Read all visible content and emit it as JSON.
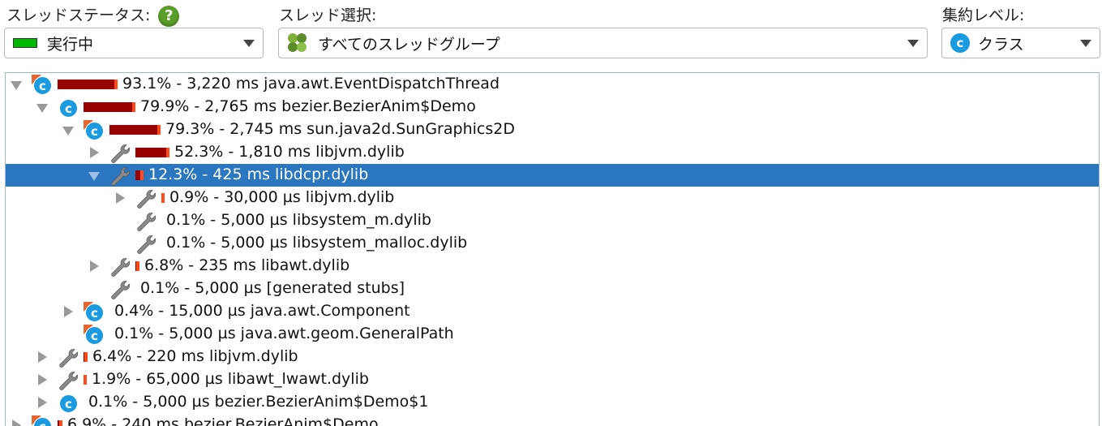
{
  "header": {
    "thread_status_label": "スレッドステータス:",
    "thread_status_value": "実行中",
    "thread_select_label": "スレッド選択:",
    "thread_select_value": "すべてのスレッドグループ",
    "aggregation_label": "集約レベル:",
    "aggregation_value": "クラス",
    "help_glyph": "?",
    "class_glyph": "c"
  },
  "colors": {
    "bar_dark": "#990000",
    "bar_tip": "#ff4a1a",
    "selection": "#2a76bf",
    "class_icon": "#1a9ae0"
  },
  "tree": [
    {
      "text": "93.1% - 3,220 ms java.awt.EventDispatchThread",
      "depth": 0,
      "icon": "class-icon",
      "corner": true,
      "toggle": "expanded",
      "bar_percent": 93.1
    },
    {
      "text": "79.9% - 2,765 ms bezier.BezierAnim$Demo",
      "depth": 1,
      "icon": "class-icon",
      "corner": false,
      "toggle": "expanded",
      "bar_percent": 79.9
    },
    {
      "text": "79.3% - 2,745 ms sun.java2d.SunGraphics2D",
      "depth": 2,
      "icon": "class-icon",
      "corner": true,
      "toggle": "expanded",
      "bar_percent": 79.3
    },
    {
      "text": "52.3% - 1,810 ms libjvm.dylib",
      "depth": 3,
      "icon": "wrench-icon",
      "corner": false,
      "toggle": "collapsed",
      "bar_percent": 52.3
    },
    {
      "text": "12.3% - 425 ms libdcpr.dylib",
      "depth": 3,
      "icon": "wrench-icon",
      "corner": false,
      "toggle": "expanded",
      "bar_percent": 12.3,
      "selected": true
    },
    {
      "text": "0.9% - 30,000 µs libjvm.dylib",
      "depth": 4,
      "icon": "wrench-icon",
      "corner": false,
      "toggle": "collapsed",
      "bar_percent": 0.9
    },
    {
      "text": "0.1% - 5,000 µs libsystem_m.dylib",
      "depth": 4,
      "icon": "wrench-icon",
      "corner": false,
      "toggle": "none",
      "bar_percent": 0.1
    },
    {
      "text": "0.1% - 5,000 µs libsystem_malloc.dylib",
      "depth": 4,
      "icon": "wrench-icon",
      "corner": false,
      "toggle": "none",
      "bar_percent": 0.1
    },
    {
      "text": "6.8% - 235 ms libawt.dylib",
      "depth": 3,
      "icon": "wrench-icon",
      "corner": false,
      "toggle": "collapsed",
      "bar_percent": 6.8
    },
    {
      "text": "0.1% - 5,000 µs [generated stubs]",
      "depth": 3,
      "icon": "wrench-icon",
      "corner": false,
      "toggle": "none",
      "bar_percent": 0.1
    },
    {
      "text": "0.4% - 15,000 µs java.awt.Component",
      "depth": 2,
      "icon": "class-icon",
      "corner": true,
      "toggle": "collapsed",
      "bar_percent": 0.4
    },
    {
      "text": "0.1% - 5,000 µs java.awt.geom.GeneralPath",
      "depth": 2,
      "icon": "class-icon",
      "corner": true,
      "toggle": "none",
      "bar_percent": 0.1
    },
    {
      "text": "6.4% - 220 ms libjvm.dylib",
      "depth": 1,
      "icon": "wrench-icon",
      "corner": false,
      "toggle": "collapsed",
      "bar_percent": 6.4
    },
    {
      "text": "1.9% - 65,000 µs libawt_lwawt.dylib",
      "depth": 1,
      "icon": "wrench-icon",
      "corner": false,
      "toggle": "collapsed",
      "bar_percent": 1.9
    },
    {
      "text": "0.1% - 5,000 µs bezier.BezierAnim$Demo$1",
      "depth": 1,
      "icon": "class-icon",
      "corner": false,
      "toggle": "collapsed",
      "bar_percent": 0.1
    },
    {
      "text": "6.9% - 240 ms bezier.BezierAnim$Demo",
      "depth": 0,
      "icon": "class-icon",
      "corner": true,
      "toggle": "collapsed",
      "bar_percent": 6.9
    }
  ]
}
